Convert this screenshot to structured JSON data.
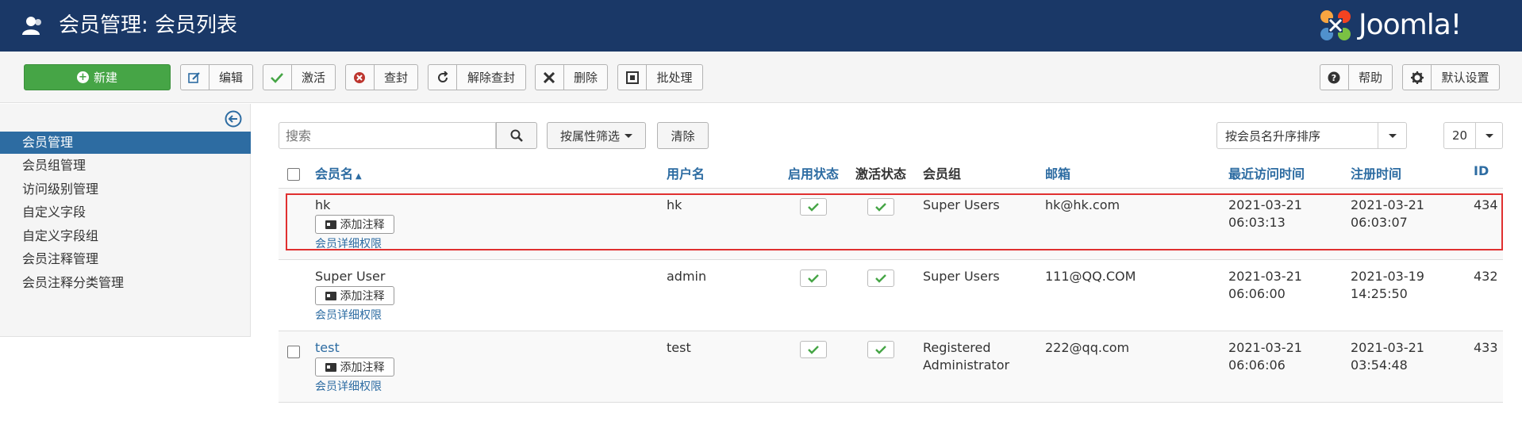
{
  "header": {
    "title": "会员管理: 会员列表",
    "logo_text": "Joomla!"
  },
  "toolbar": {
    "new_label": "新建",
    "edit_label": "编辑",
    "activate_label": "激活",
    "block_label": "查封",
    "unblock_label": "解除查封",
    "delete_label": "删除",
    "batch_label": "批处理",
    "help_label": "帮助",
    "options_label": "默认设置"
  },
  "sidebar": {
    "items": [
      {
        "label": "会员管理",
        "active": true
      },
      {
        "label": "会员组管理"
      },
      {
        "label": "访问级别管理"
      },
      {
        "label": "自定义字段"
      },
      {
        "label": "自定义字段组"
      },
      {
        "label": "会员注释管理"
      },
      {
        "label": "会员注释分类管理"
      }
    ]
  },
  "filters": {
    "search_placeholder": "搜索",
    "filter_label": "按属性筛选",
    "clear_label": "清除",
    "sort_value": "按会员名升序排序",
    "limit_value": "20"
  },
  "table": {
    "columns": {
      "name": "会员名",
      "username": "用户名",
      "enabled": "启用状态",
      "activated": "激活状态",
      "groups": "会员组",
      "email": "邮箱",
      "last_visit": "最近访问时间",
      "registered": "注册时间",
      "id": "ID"
    },
    "add_note_label": "添加注释",
    "permissions_label": "会员详细权限",
    "rows": [
      {
        "name": "hk",
        "username": "hk",
        "group_line1": "Super Users",
        "group_line2": "",
        "email": "hk@hk.com",
        "last_visit_date": "2021-03-21",
        "last_visit_time": "06:03:13",
        "registered_date": "2021-03-21",
        "registered_time": "06:03:07",
        "id": "434"
      },
      {
        "name": "Super User",
        "username": "admin",
        "group_line1": "Super Users",
        "group_line2": "",
        "email": "111@QQ.COM",
        "last_visit_date": "2021-03-21",
        "last_visit_time": "06:06:00",
        "registered_date": "2021-03-19",
        "registered_time": "14:25:50",
        "id": "432"
      },
      {
        "name": "test",
        "username": "test",
        "group_line1": "Registered",
        "group_line2": "Administrator",
        "email": "222@qq.com",
        "last_visit_date": "2021-03-21",
        "last_visit_time": "06:06:06",
        "registered_date": "2021-03-21",
        "registered_time": "03:54:48",
        "id": "433"
      }
    ]
  },
  "colors": {
    "header_bg": "#1a3867",
    "accent": "#2d6ca2",
    "success": "#46a546",
    "highlight": "#e03030"
  }
}
